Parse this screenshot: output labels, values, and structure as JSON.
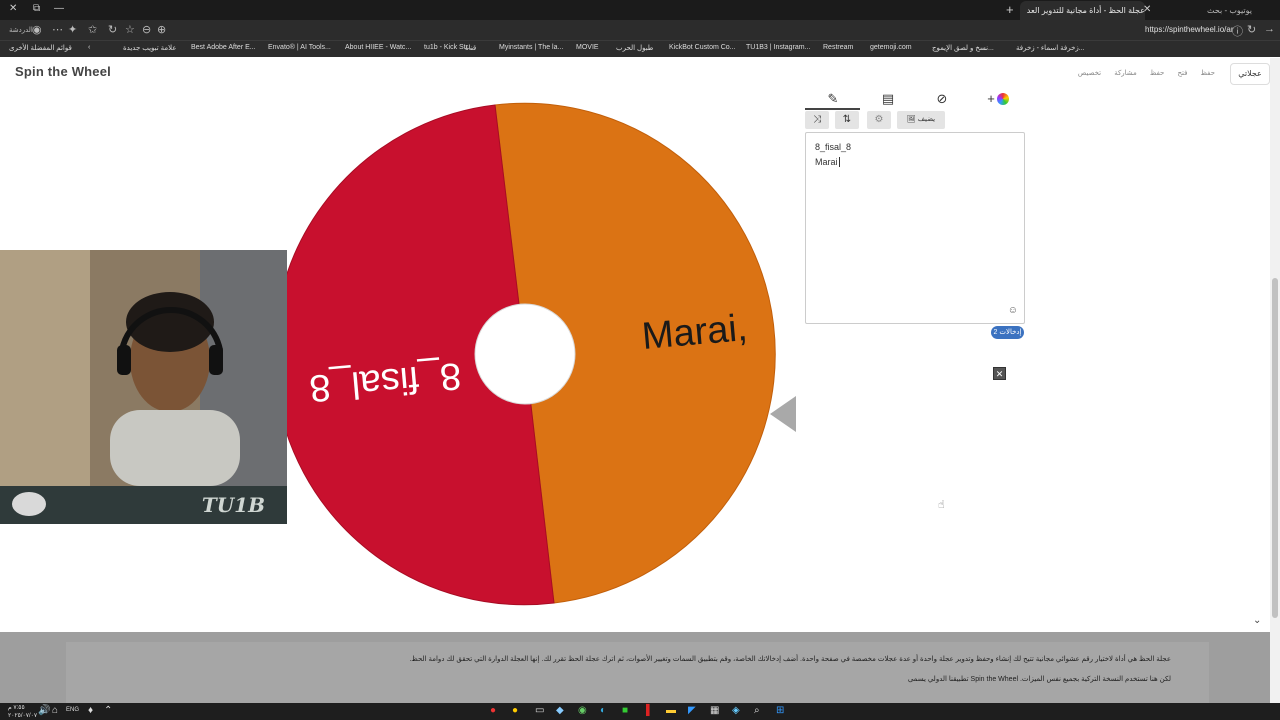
{
  "browser": {
    "active_tab_title": "عجلة الحظ - أداة مجانية للتدوير العد",
    "inactive_tab_title": "يوتيوب - بحث",
    "url": "https://spinthewheel.io/ar",
    "sidebar_label": "الدردشة",
    "bookmarks": [
      "قوائم المفضلة الأخرى",
      "علامة تبويب جديدة",
      "Best Adobe After E...",
      "Envato® | AI Tools...",
      "About HIIEE - Watc...",
      "tu1b - Kick Str...",
      "قناة",
      "Myinstants | The la...",
      "MOVIE",
      "طبول الحرب",
      "KickBot Custom Co...",
      "TU1B3 | Instagram...",
      "Restream",
      "getemoji.com",
      "نسخ و لصق الإيموج...",
      "زخرفة اسماء - زخرفة..."
    ]
  },
  "site": {
    "logo": "Spin the Wheel",
    "nav": [
      "حفظ",
      "فتح",
      "حفظ",
      "مشاركة",
      "تخصيص"
    ],
    "language_button": "عجلاتي"
  },
  "wheel": {
    "segments": [
      {
        "label": "Marai,",
        "color": "#db7314"
      },
      {
        "label": "8_fisal_8",
        "color": "#c8102e"
      }
    ]
  },
  "editor": {
    "tabs": [
      "edit-icon",
      "clipboard-icon",
      "hide-icon",
      "add-color-icon"
    ],
    "toolbar": {
      "shuffle_label": "⤨",
      "sort_label": "⇅",
      "settings_label": "⚙",
      "add_image_label": "🖼 يضيف"
    },
    "entries": [
      "8_fisal_8",
      "Marai"
    ],
    "entries_badge": "إدخالات 2"
  },
  "footer": {
    "line1": "عجلة الحظ هي أداة لاختيار رقم عشوائي مجانية تتيح لك إنشاء وحفظ وتدوير عجلة واحدة أو عدة عجلات مخصصة في صفحة واحدة. أضف إدخالاتك الخاصة، وقم بتطبيق السمات وتغيير الأصوات، ثم اترك عجلة الحظ تقرر لك. إنها العجلة الدوارة التي تحقق لك دوامة الحظ.",
    "line2": "لكن هنا تستخدم النسخة التركية بجميع نفس الميزات. Spin the Wheel تطبيقنا الدولي يسمى"
  },
  "webcam": {
    "brand": "TU1B"
  },
  "taskbar": {
    "time": "٧:٥٥ م",
    "date": "٢٠٢٥/٠٧/٠٧",
    "lang": "ENG"
  }
}
